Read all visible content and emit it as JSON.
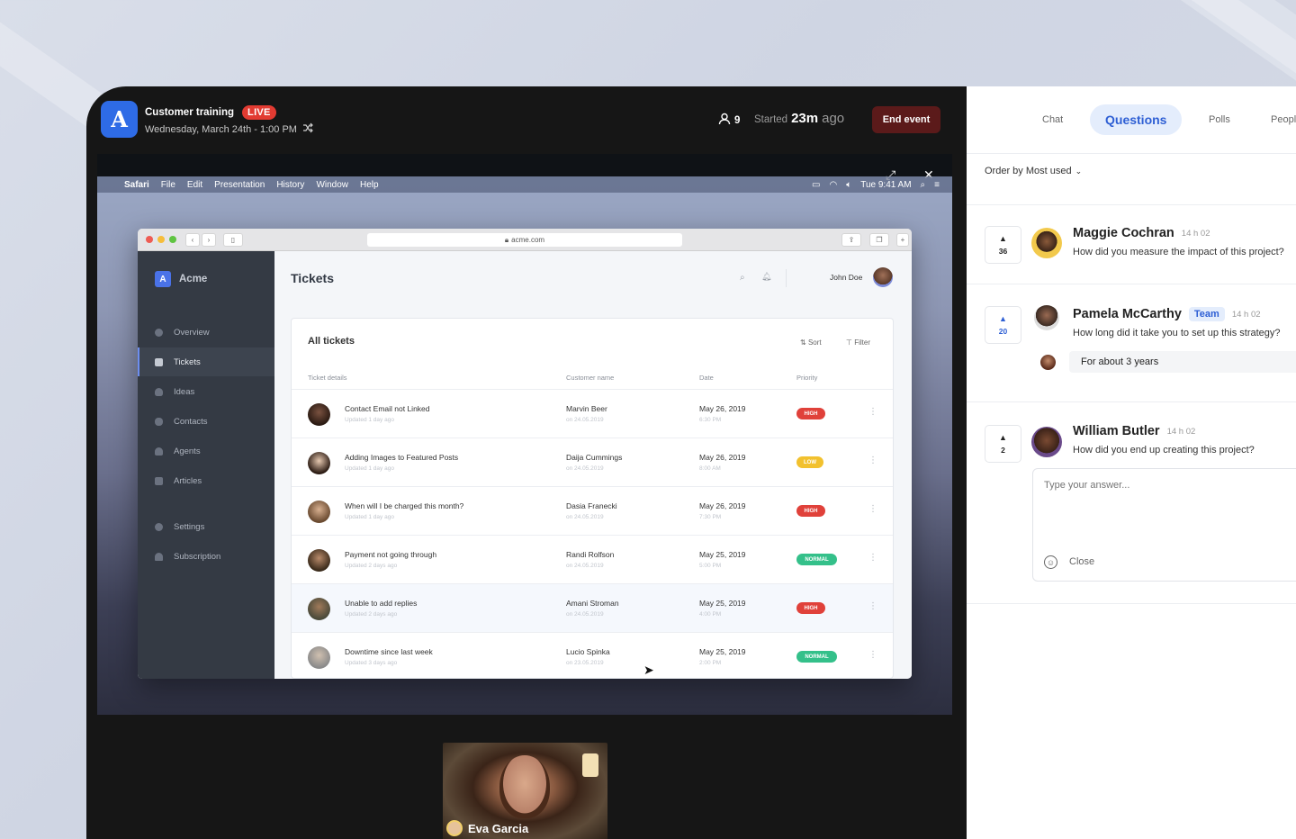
{
  "event": {
    "logo_letter": "A",
    "title": "Customer training",
    "live_label": "LIVE",
    "date": "Wednesday, March 24th - 1:00 PM",
    "attendee_count": "9",
    "started_prefix": "Started",
    "started_value": "23m",
    "started_suffix": "ago",
    "end_label": "End event"
  },
  "mac_menu": [
    "Safari",
    "File",
    "Edit",
    "Presentation",
    "History",
    "Window",
    "Help"
  ],
  "mac_clock": "Tue 9:41 AM",
  "browser": {
    "url": "acme.com"
  },
  "acme": {
    "brand": "Acme",
    "brand_letter": "A",
    "nav": [
      "Overview",
      "Tickets",
      "Ideas",
      "Contacts",
      "Agents",
      "Articles",
      "Settings",
      "Subscription"
    ],
    "active_nav": "Tickets",
    "page_title": "Tickets",
    "user": "John Doe",
    "card_title": "All tickets",
    "sort_label": "Sort",
    "filter_label": "Filter",
    "columns": [
      "Ticket details",
      "Customer name",
      "Date",
      "Priority"
    ],
    "rows": [
      {
        "title": "Contact Email not Linked",
        "updated": "Updated 1 day ago",
        "customer": "Marvin Beer",
        "since": "on 24.05.2019",
        "date": "May 26, 2019",
        "time": "6:30 PM",
        "priority": "HIGH"
      },
      {
        "title": "Adding Images to Featured Posts",
        "updated": "Updated 1 day ago",
        "customer": "Daija Cummings",
        "since": "on 24.05.2019",
        "date": "May 26, 2019",
        "time": "8:00 AM",
        "priority": "LOW"
      },
      {
        "title": "When will I be charged this month?",
        "updated": "Updated 1 day ago",
        "customer": "Dasia Franecki",
        "since": "on 24.05.2019",
        "date": "May 26, 2019",
        "time": "7:30 PM",
        "priority": "HIGH"
      },
      {
        "title": "Payment not going through",
        "updated": "Updated 2 days ago",
        "customer": "Randi Rolfson",
        "since": "on 24.05.2019",
        "date": "May 25, 2019",
        "time": "5:00 PM",
        "priority": "NORMAL"
      },
      {
        "title": "Unable to add replies",
        "updated": "Updated 2 days ago",
        "customer": "Amani Stroman",
        "since": "on 24.05.2019",
        "date": "May 25, 2019",
        "time": "4:00 PM",
        "priority": "HIGH"
      },
      {
        "title": "Downtime since last week",
        "updated": "Updated 3 days ago",
        "customer": "Lucio Spinka",
        "since": "on 23.05.2019",
        "date": "May 25, 2019",
        "time": "2:00 PM",
        "priority": "NORMAL"
      }
    ]
  },
  "presenter": {
    "name": "Eva Garcia"
  },
  "panel": {
    "tabs": [
      "Chat",
      "Questions",
      "Polls",
      "People"
    ],
    "active_tab": "Questions",
    "order_label": "Order by Most used",
    "questions": [
      {
        "votes": "36",
        "name": "Maggie Cochran",
        "time": "14 h 02",
        "text": "How did you measure the impact of this project?"
      },
      {
        "votes": "20",
        "name": "Pamela McCarthy",
        "badge": "Team",
        "time": "14 h 02",
        "text": "How long did it take you to set up this strategy?",
        "answer": "For about 3 years"
      },
      {
        "votes": "2",
        "name": "William Butler",
        "time": "14 h 02",
        "text": "How did you end up creating this project?"
      }
    ],
    "reply_placeholder": "Type your answer...",
    "close_label": "Close"
  },
  "colors": {
    "accent": "#2e5fd4",
    "live": "#e23b32",
    "end_button": "#5b1a1a",
    "priority_high": "#e0413a",
    "priority_low": "#f2c12e",
    "priority_normal": "#34c08a"
  }
}
